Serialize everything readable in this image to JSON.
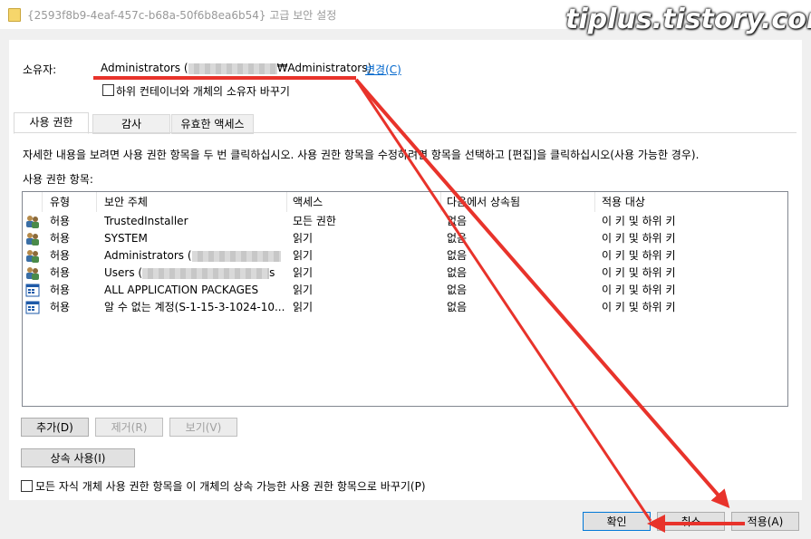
{
  "window": {
    "title": "{2593f8b9-4eaf-457c-b68a-50f6b8ea6b54} 고급 보안 설정",
    "watermark": "tiplus.tistory.com"
  },
  "owner": {
    "label": "소유자:",
    "prefix": "Administrators (",
    "suffix": "₩Administrators)",
    "change_link": "변경(C)",
    "replace_checkbox_label": "하위 컨테이너와 개체의 소유자 바꾸기",
    "replace_checked": false
  },
  "tabs": [
    {
      "label": "사용 권한",
      "active": true
    },
    {
      "label": "감사",
      "active": false
    },
    {
      "label": "유효한 액세스",
      "active": false
    }
  ],
  "instructions": "자세한 내용을 보려면 사용 권한 항목을 두 번 클릭하십시오. 사용 권한 항목을 수정하려면 항목을 선택하고 [편집]을 클릭하십시오(사용 가능한 경우).",
  "entries_label": "사용 권한 항목:",
  "columns": [
    "유형",
    "보안 주체",
    "액세스",
    "다음에서 상속됨",
    "적용 대상"
  ],
  "rows": [
    {
      "icon": "users-icon",
      "type": "허용",
      "principal": "TrustedInstaller",
      "access": "모든 권한",
      "inherited": "없음",
      "applies": "이 키 및 하위 키"
    },
    {
      "icon": "users-icon",
      "type": "허용",
      "principal": "SYSTEM",
      "access": "읽기",
      "inherited": "없음",
      "applies": "이 키 및 하위 키"
    },
    {
      "icon": "users-icon",
      "type": "허용",
      "principal": "Administrators (",
      "access": "읽기",
      "inherited": "없음",
      "applies": "이 키 및 하위 키"
    },
    {
      "icon": "users-icon",
      "type": "허용",
      "principal": "Users (",
      "access": "읽기",
      "inherited": "없음",
      "applies": "이 키 및 하위 키"
    },
    {
      "icon": "package-icon",
      "type": "허용",
      "principal": "ALL APPLICATION PACKAGES",
      "access": "읽기",
      "inherited": "없음",
      "applies": "이 키 및 하위 키"
    },
    {
      "icon": "package-icon",
      "type": "허용",
      "principal": "알 수 없는 계정(S-1-15-3-1024-10...",
      "access": "읽기",
      "inherited": "없음",
      "applies": "이 키 및 하위 키"
    }
  ],
  "buttons": {
    "add": "추가(D)",
    "remove": "제거(R)",
    "view": "보기(V)",
    "inherit": "상속 사용(I)",
    "ok": "확인",
    "cancel": "취소",
    "apply": "적용(A)"
  },
  "replace_child": {
    "label": "모든 자식 개체 사용 권한 항목을 이 개체의 상속 가능한 사용 권한 항목으로 바꾸기(P)",
    "checked": false
  },
  "annotation_color": "#e8332b"
}
